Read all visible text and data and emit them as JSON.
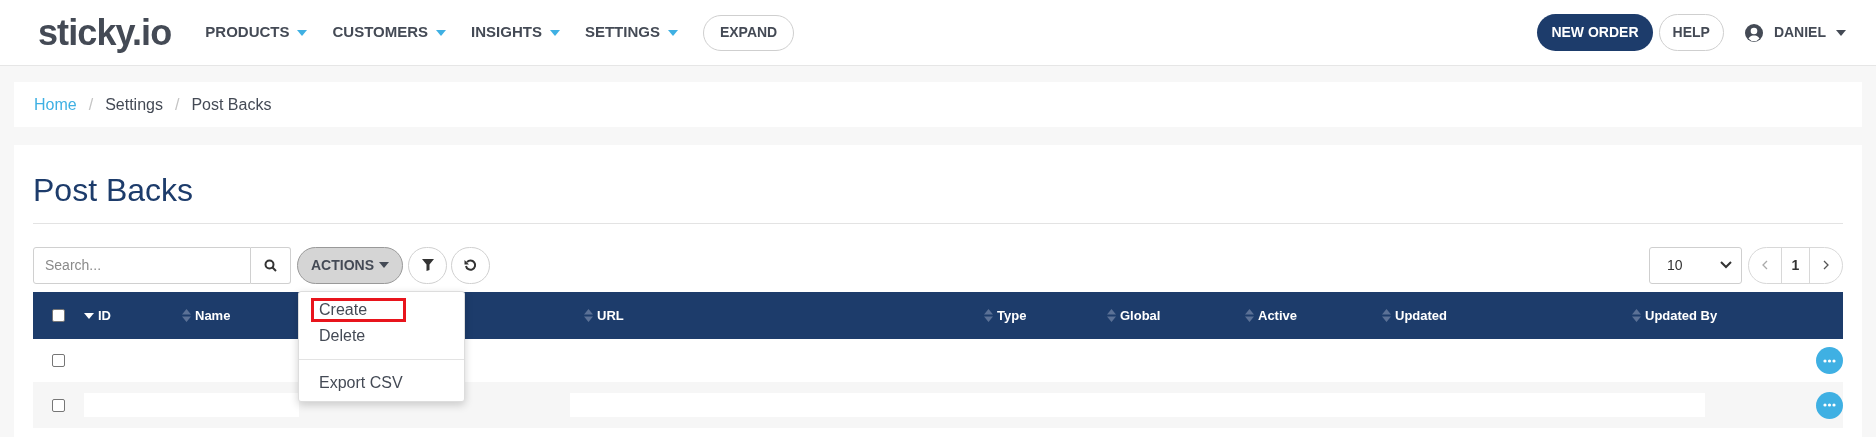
{
  "header": {
    "logo": "sticky.io",
    "nav": [
      {
        "label": "PRODUCTS"
      },
      {
        "label": "CUSTOMERS"
      },
      {
        "label": "INSIGHTS"
      },
      {
        "label": "SETTINGS"
      }
    ],
    "expand_button": "EXPAND",
    "new_order_button": "NEW ORDER",
    "help_button": "HELP",
    "user": "DANIEL"
  },
  "breadcrumb_separator": "/",
  "breadcrumb": [
    {
      "label": "Home",
      "link": true
    },
    {
      "label": "Settings",
      "link": false
    },
    {
      "label": "Post Backs",
      "link": false
    }
  ],
  "page_title": "Post Backs",
  "toolbar": {
    "search": {
      "placeholder": "Search..."
    },
    "actions": {
      "label": "ACTIONS",
      "expanded": true
    },
    "page_size": "10",
    "page": "1"
  },
  "actions_menu": [
    {
      "kind": "item",
      "label": "Create",
      "highlighted": true
    },
    {
      "kind": "item",
      "label": "Delete",
      "highlighted": false
    },
    {
      "kind": "divider"
    },
    {
      "kind": "item",
      "label": "Export CSV",
      "highlighted": false
    }
  ],
  "table": {
    "select_all": {
      "checked": false
    },
    "columns": [
      {
        "label": "ID",
        "sorted": true
      },
      {
        "label": "Name",
        "sorted": false
      },
      {
        "label": "URL",
        "sorted": false
      },
      {
        "label": "Type",
        "sorted": false
      },
      {
        "label": "Global",
        "sorted": false
      },
      {
        "label": "Active",
        "sorted": false
      },
      {
        "label": "Updated",
        "sorted": false
      },
      {
        "label": "Updated By",
        "sorted": false
      }
    ],
    "rows": [
      {
        "checked": false
      },
      {
        "checked": false
      }
    ]
  }
}
